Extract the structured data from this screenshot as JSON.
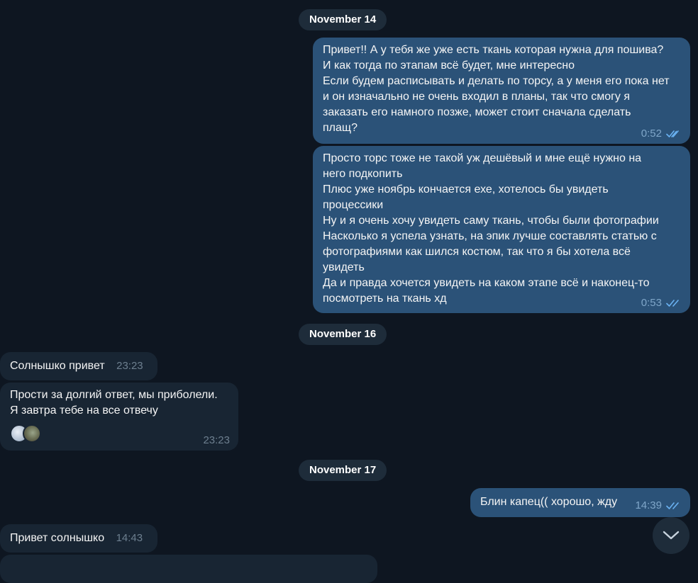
{
  "dates": {
    "nov14": "November 14",
    "nov16": "November 16",
    "nov17": "November 17"
  },
  "messages": {
    "m1": {
      "lines": "Привет!! А у тебя же уже есть ткань которая нужна для пошива?\nИ как тогда по этапам всё будет, мне интересно\nЕсли будем расписывать и делать по торсу, а у меня его пока нет\nи он изначально не очень входил в планы, так что смогу я\nзаказать его намного позже, может стоит сначала сделать\nплащ?",
      "time": "0:52",
      "status": "read"
    },
    "m2": {
      "lines": "Просто торс тоже не такой уж дешёвый и мне ещё нужно на\nнего подкопить\nПлюс уже ноябрь кончается ехе, хотелось бы увидеть\nпроцессики\nНу и я очень хочу увидеть саму ткань, чтобы были фотографии\nНасколько я успела узнать, на эпик лучше составлять статью с\nфотографиями как шился костюм, так что я бы хотела всё\nувидеть\nДа и правда хочется увидеть на каком этапе всё и наконец-то\nпосмотреть на ткань хд",
      "time": "0:53",
      "status": "read"
    },
    "m3": {
      "text": "Солнышко привет",
      "time": "23:23"
    },
    "m4": {
      "lines": "Прости за долгий ответ, мы приболели.\nЯ завтра тебе на все отвечу",
      "time": "23:23"
    },
    "m5": {
      "text": "Блин капец(( хорошо, жду",
      "time": "14:39",
      "status": "read"
    },
    "m6": {
      "text": "Привет солнышко",
      "time": "14:43"
    }
  },
  "icons": {
    "read": "double-check-icon",
    "scroll": "chevron-down-icon"
  },
  "colors": {
    "background": "#0e1621",
    "outgoing_bubble": "#2b5278",
    "incoming_bubble": "#182533",
    "date_pill": "#1e2c3a",
    "read_ticks": "#6ab2f2"
  }
}
